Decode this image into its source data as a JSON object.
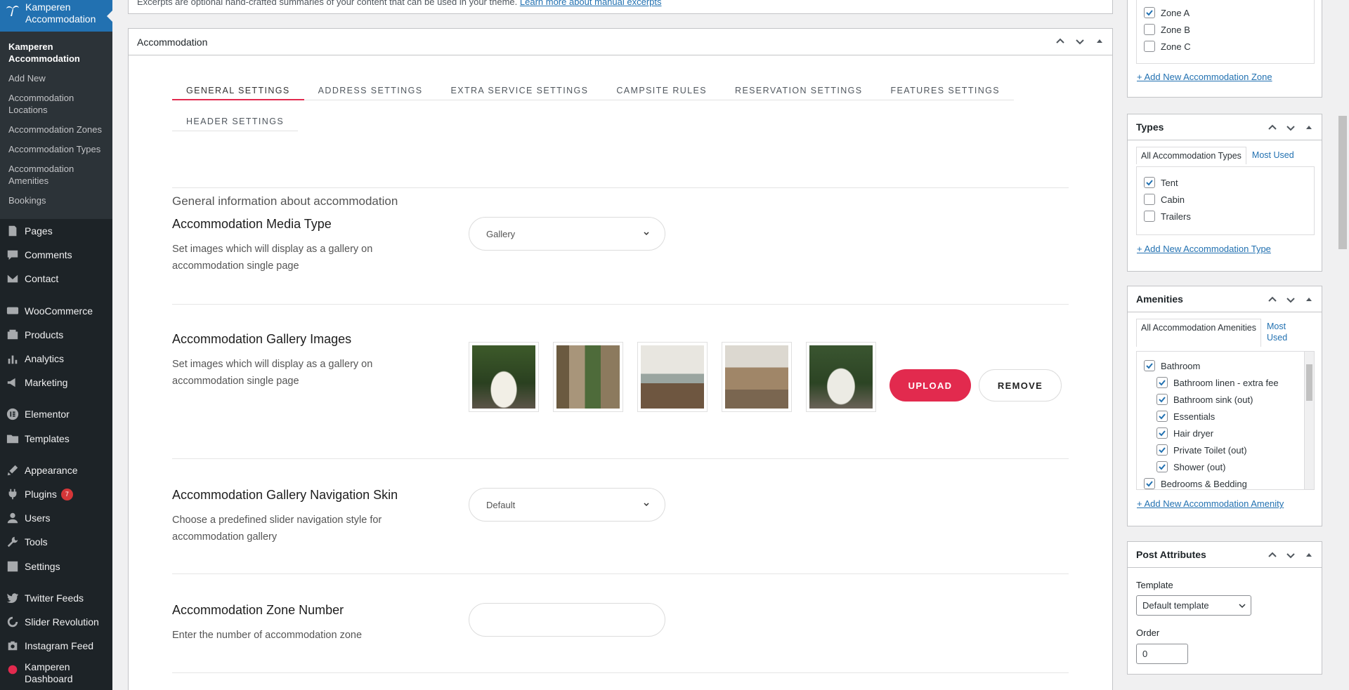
{
  "admin_menu": {
    "current": "Kamperen Accommodation",
    "submenu": [
      {
        "label": "Kamperen Accommodation"
      },
      {
        "label": "Add New"
      },
      {
        "label": "Accommodation Locations"
      },
      {
        "label": "Accommodation Zones"
      },
      {
        "label": "Accommodation Types"
      },
      {
        "label": "Accommodation Amenities"
      },
      {
        "label": "Bookings"
      }
    ],
    "items": [
      {
        "label": "Pages",
        "icon": "pages-icon"
      },
      {
        "label": "Comments",
        "icon": "comments-icon"
      },
      {
        "label": "Contact",
        "icon": "contact-icon"
      },
      {
        "label": "WooCommerce",
        "icon": "woocommerce-icon"
      },
      {
        "label": "Products",
        "icon": "products-icon"
      },
      {
        "label": "Analytics",
        "icon": "analytics-icon"
      },
      {
        "label": "Marketing",
        "icon": "marketing-icon"
      },
      {
        "label": "Elementor",
        "icon": "elementor-icon"
      },
      {
        "label": "Templates",
        "icon": "templates-icon"
      },
      {
        "label": "Appearance",
        "icon": "appearance-icon"
      },
      {
        "label": "Plugins",
        "icon": "plugins-icon",
        "badge": "7"
      },
      {
        "label": "Users",
        "icon": "users-icon"
      },
      {
        "label": "Tools",
        "icon": "tools-icon"
      },
      {
        "label": "Settings",
        "icon": "settings-icon"
      },
      {
        "label": "Twitter Feeds",
        "icon": "twitter-icon"
      },
      {
        "label": "Slider Revolution",
        "icon": "slider-revolution-icon"
      },
      {
        "label": "Instagram Feed",
        "icon": "instagram-icon"
      },
      {
        "label": "Kamperen Dashboard",
        "icon": "kamperen-dashboard-icon"
      }
    ]
  },
  "excerpt_note": {
    "text": "Excerpts are optional hand-crafted summaries of your content that can be used in your theme.",
    "link": "Learn more about manual excerpts"
  },
  "accommodation_box": {
    "title": "Accommodation",
    "tabs": [
      "GENERAL SETTINGS",
      "ADDRESS SETTINGS",
      "EXTRA SERVICE SETTINGS",
      "CAMPSITE RULES",
      "RESERVATION SETTINGS",
      "FEATURES SETTINGS",
      "HEADER SETTINGS"
    ],
    "active_tab": "GENERAL SETTINGS",
    "section_title": "General information about accommodation",
    "fields": {
      "media_type": {
        "label": "Accommodation Media Type",
        "desc": "Set images which will display as a gallery on accommodation single page",
        "value": "Gallery"
      },
      "gallery_images": {
        "label": "Accommodation Gallery Images",
        "desc": "Set images which will display as a gallery on accommodation single page",
        "upload": "UPLOAD",
        "remove": "REMOVE"
      },
      "nav_skin": {
        "label": "Accommodation Gallery Navigation Skin",
        "desc": "Choose a predefined slider navigation style for accommodation gallery",
        "value": "Default"
      },
      "zone_number": {
        "label": "Accommodation Zone Number",
        "desc": "Enter the number of accommodation zone",
        "value": ""
      }
    }
  },
  "sidebar": {
    "zones": {
      "items": [
        {
          "label": "Zone A",
          "checked": true
        },
        {
          "label": "Zone B",
          "checked": false
        },
        {
          "label": "Zone C",
          "checked": false
        }
      ],
      "add_link": "+ Add New Accommodation Zone"
    },
    "types": {
      "title": "Types",
      "tab_all": "All Accommodation Types",
      "tab_most": "Most Used",
      "items": [
        {
          "label": "Tent",
          "checked": true
        },
        {
          "label": "Cabin",
          "checked": false
        },
        {
          "label": "Trailers",
          "checked": false
        }
      ],
      "add_link": "+ Add New Accommodation Type"
    },
    "amenities": {
      "title": "Amenities",
      "tab_all": "All Accommodation Amenities",
      "tab_most": "Most Used",
      "items": [
        {
          "label": "Bathroom",
          "checked": true,
          "child": false
        },
        {
          "label": "Bathroom linen - extra fee",
          "checked": true,
          "child": true
        },
        {
          "label": "Bathroom sink (out)",
          "checked": true,
          "child": true
        },
        {
          "label": "Essentials",
          "checked": true,
          "child": true
        },
        {
          "label": "Hair dryer",
          "checked": true,
          "child": true
        },
        {
          "label": "Private Toilet (out)",
          "checked": true,
          "child": true
        },
        {
          "label": "Shower (out)",
          "checked": true,
          "child": true
        },
        {
          "label": "Bedrooms & Bedding",
          "checked": true,
          "child": false
        }
      ],
      "add_link": "+ Add New Accommodation Amenity"
    },
    "post_attributes": {
      "title": "Post Attributes",
      "template_label": "Template",
      "template_value": "Default template",
      "order_label": "Order",
      "order_value": "0"
    }
  },
  "colors": {
    "accent": "#e22a4e",
    "admin_bg": "#1d2327",
    "admin_current": "#2271b1",
    "link": "#2271b1"
  }
}
